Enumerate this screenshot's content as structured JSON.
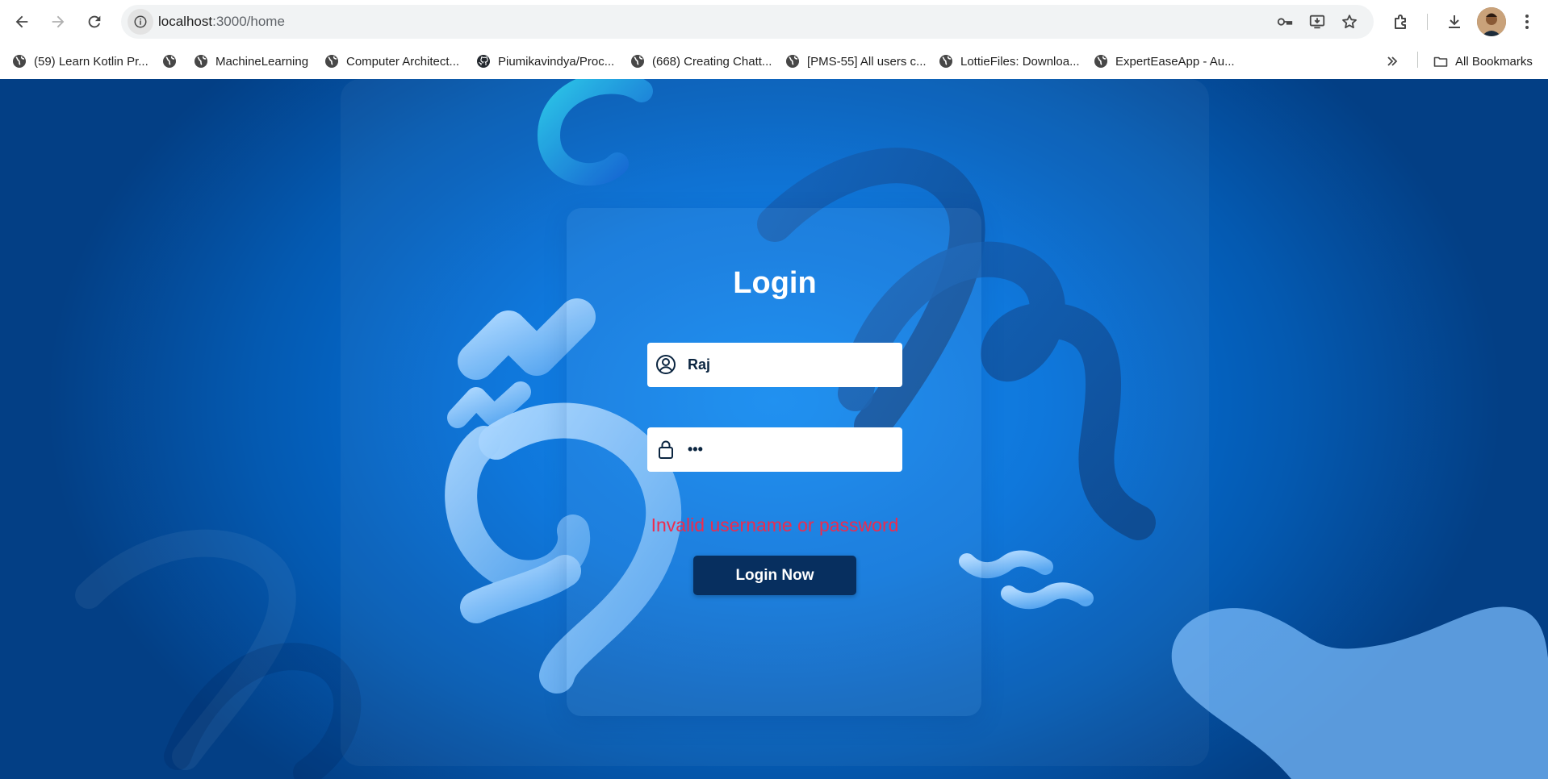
{
  "browser": {
    "url_host": "localhost",
    "url_path": ":3000/home",
    "nav": {
      "back_icon": "back-arrow-icon",
      "forward_icon": "forward-arrow-icon",
      "reload_icon": "reload-icon"
    }
  },
  "bookmarks": {
    "items": [
      {
        "label": "(59) Learn Kotlin Pr...",
        "icon": "globe-icon"
      },
      {
        "label": "",
        "icon": "globe-icon"
      },
      {
        "label": "MachineLearning",
        "icon": "globe-icon"
      },
      {
        "label": "Computer Architect...",
        "icon": "globe-icon"
      },
      {
        "label": "Piumikavindya/Proc...",
        "icon": "github-icon"
      },
      {
        "label": "(668) Creating Chatt...",
        "icon": "globe-icon"
      },
      {
        "label": "[PMS-55] All users c...",
        "icon": "globe-icon"
      },
      {
        "label": "LottieFiles: Downloa...",
        "icon": "globe-icon"
      },
      {
        "label": "ExpertEaseApp - Au...",
        "icon": "globe-icon"
      }
    ],
    "all_bookmarks_label": "All Bookmarks"
  },
  "login": {
    "title": "Login",
    "username_value": "Raj",
    "password_value": "•••",
    "error": "Invalid username or password",
    "button_label": "Login Now"
  },
  "colors": {
    "background_center": "#0a86f0",
    "background_edge": "#033f85",
    "button": "#072f5f",
    "error": "#ee2b4d"
  }
}
